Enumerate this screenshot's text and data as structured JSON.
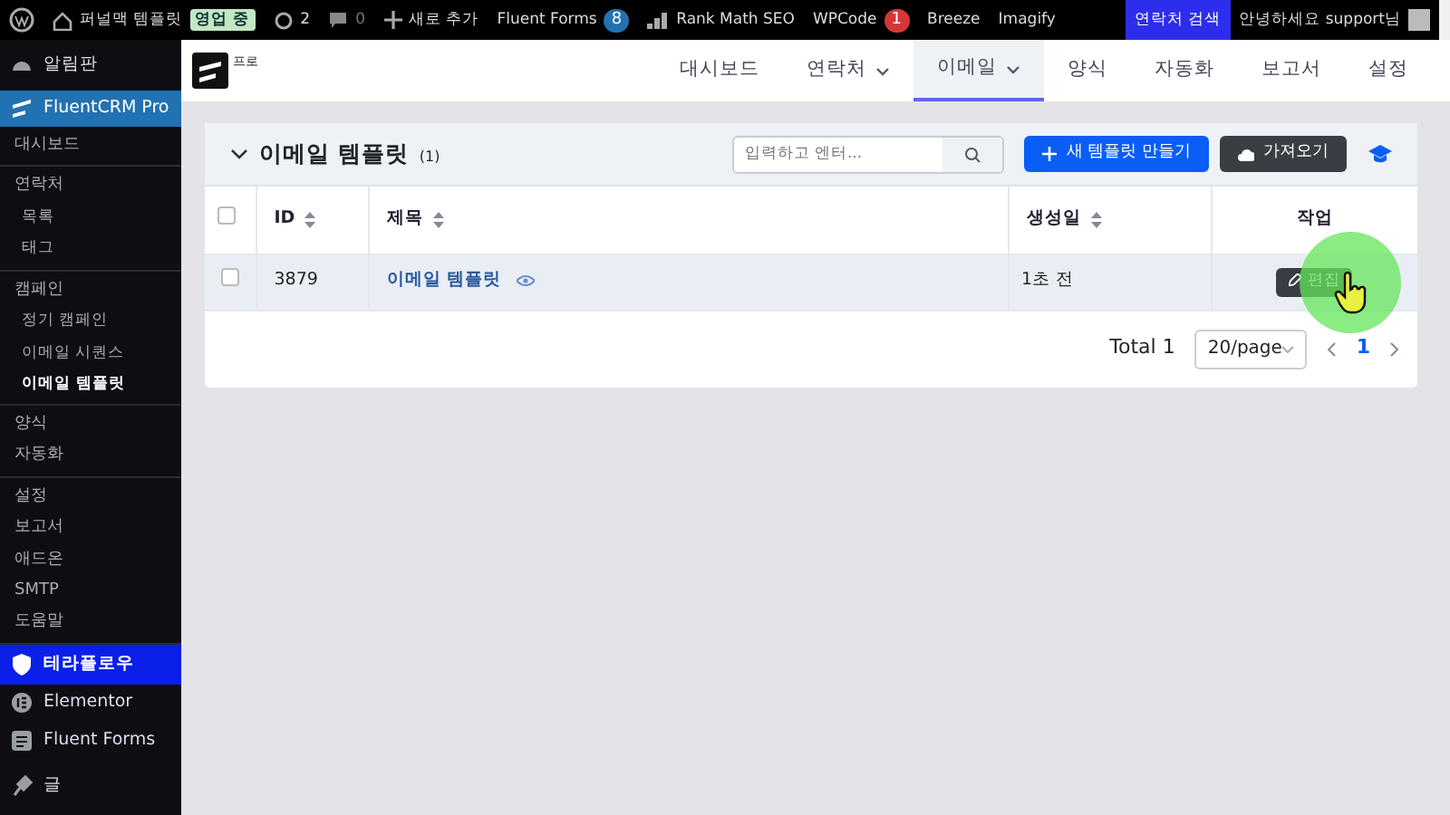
{
  "admin_bar": {
    "site": "퍼널맥 템플릿",
    "site_badge": "영업 중",
    "updates": "2",
    "comments": "0",
    "new": "새로 추가",
    "items": [
      {
        "label": "Fluent Forms",
        "count": "8",
        "color": "#2271b1"
      },
      {
        "label": "Rank Math SEO"
      },
      {
        "label": "WPCode",
        "count": "1",
        "color": "#d63638"
      },
      {
        "label": "Breeze"
      },
      {
        "label": "Imagify"
      }
    ],
    "search": "연락처 검색",
    "greeting": "안녕하세요 support님"
  },
  "sidebar": {
    "top": [
      {
        "label": "알림판",
        "selected": false
      },
      {
        "label": "FluentCRM Pro",
        "selected": true
      }
    ],
    "groups": [
      [
        {
          "label": "대시보드",
          "kind": "item",
          "selected": false
        }
      ],
      [
        {
          "label": "연락처",
          "kind": "item",
          "selected": false
        },
        {
          "label": "목록",
          "kind": "sub",
          "selected": false
        },
        {
          "label": "태그",
          "kind": "sub",
          "selected": false
        }
      ],
      [
        {
          "label": "캠페인",
          "kind": "item",
          "selected": false
        },
        {
          "label": "정기 캠페인",
          "kind": "sub",
          "selected": false
        },
        {
          "label": "이메일 시퀀스",
          "kind": "sub",
          "selected": false
        },
        {
          "label": "이메일 템플릿",
          "kind": "sub",
          "selected": true
        }
      ],
      [
        {
          "label": "양식",
          "kind": "item",
          "selected": false
        },
        {
          "label": "자동화",
          "kind": "item",
          "selected": false
        }
      ],
      [
        {
          "label": "설정",
          "kind": "item",
          "selected": false
        },
        {
          "label": "보고서",
          "kind": "item",
          "selected": false
        },
        {
          "label": "애드온",
          "kind": "item",
          "selected": false
        },
        {
          "label": "SMTP",
          "kind": "item",
          "selected": false
        },
        {
          "label": "도움말",
          "kind": "item",
          "selected": false
        }
      ]
    ],
    "bottom": [
      {
        "label": "테라플로우",
        "selected": true
      },
      {
        "label": "Elementor",
        "selected": false
      },
      {
        "label": "Fluent Forms",
        "selected": false
      },
      {
        "label": "글",
        "selected": false
      }
    ]
  },
  "logo_text": "프로",
  "nav": [
    {
      "label": "대시보드",
      "dropdown": false,
      "selected": false
    },
    {
      "label": "연락처",
      "dropdown": true,
      "selected": false
    },
    {
      "label": "이메일",
      "dropdown": true,
      "selected": true
    },
    {
      "label": "양식",
      "dropdown": false,
      "selected": false
    },
    {
      "label": "자동화",
      "dropdown": false,
      "selected": false
    },
    {
      "label": "보고서",
      "dropdown": false,
      "selected": false
    },
    {
      "label": "설정",
      "dropdown": false,
      "selected": false
    }
  ],
  "panel": {
    "title": "이메일 템플릿",
    "count": "(1)",
    "search_placeholder": "입력하고 엔터...",
    "create": "새 템플릿 만들기",
    "import": "가져오기"
  },
  "table": {
    "select_all_checked": false,
    "columns": [
      "ID",
      "제목",
      "생성일",
      "작업"
    ],
    "rows": [
      {
        "checked": false,
        "id": "3879",
        "title": "이메일 템플릿",
        "created": "1초 전",
        "action": "편집"
      }
    ]
  },
  "pagination": {
    "total": "Total 1",
    "page_size": "20/page",
    "pages": [
      {
        "label": "1",
        "selected": true
      }
    ]
  }
}
